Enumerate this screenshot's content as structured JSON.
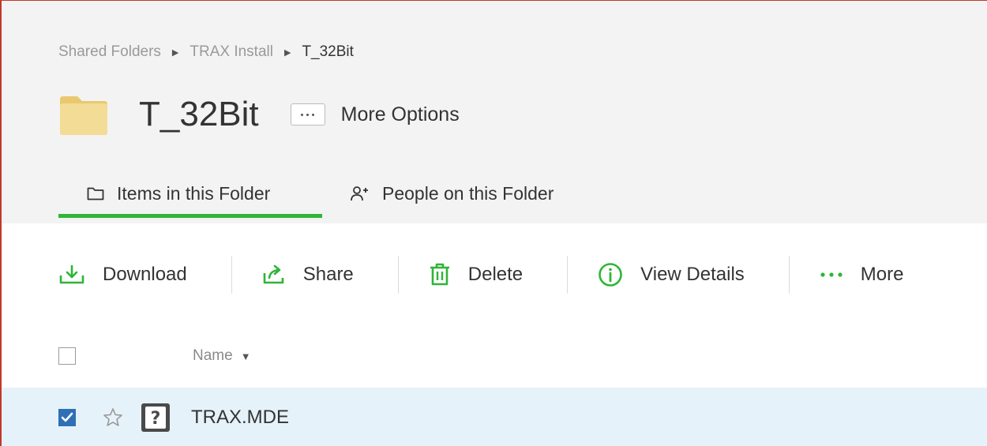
{
  "breadcrumb": {
    "items": [
      "Shared Folders",
      "TRAX Install"
    ],
    "current": "T_32Bit"
  },
  "folder": {
    "title": "T_32Bit",
    "icon": "folder-icon",
    "more_options_label": "More Options"
  },
  "tabs": [
    {
      "label": "Items in this Folder",
      "icon": "folder-outline-icon",
      "active": true
    },
    {
      "label": "People on this Folder",
      "icon": "person-add-icon",
      "active": false
    }
  ],
  "toolbar": {
    "download_label": "Download",
    "share_label": "Share",
    "delete_label": "Delete",
    "view_details_label": "View Details",
    "more_label": "More"
  },
  "list": {
    "name_header": "Name",
    "sort_indicator": "▼",
    "rows": [
      {
        "name": "TRAX.MDE",
        "checked": true,
        "starred": false,
        "icon": "unknown-file-icon"
      }
    ]
  },
  "colors": {
    "accent_green": "#2fb537",
    "checkbox_blue": "#2f6fb5",
    "selected_row": "#e6f2fa",
    "header_bg": "#f3f3f3",
    "folder_yellow": "#f0d78c"
  }
}
